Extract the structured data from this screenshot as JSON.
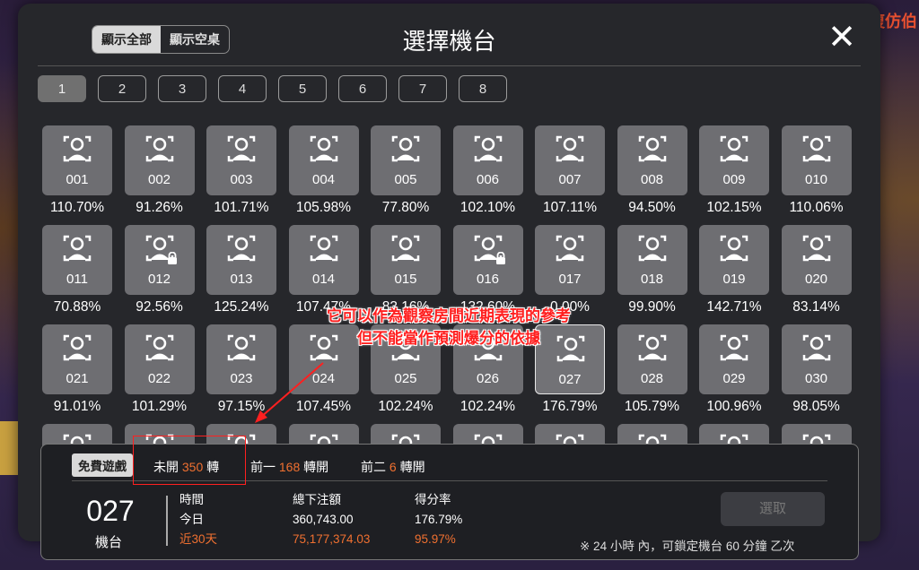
{
  "background": {
    "right_text": "復仿伯"
  },
  "modal": {
    "title": "選擇機台",
    "toggle": {
      "show_all": "顯示全部",
      "show_empty": "顯示空桌"
    },
    "pages": [
      "1",
      "2",
      "3",
      "4",
      "5",
      "6",
      "7",
      "8"
    ],
    "active_page": "1",
    "machines": [
      {
        "num": "001",
        "rate": "110.70%",
        "locked": false
      },
      {
        "num": "002",
        "rate": "91.26%",
        "locked": false
      },
      {
        "num": "003",
        "rate": "101.71%",
        "locked": false
      },
      {
        "num": "004",
        "rate": "105.98%",
        "locked": false
      },
      {
        "num": "005",
        "rate": "77.80%",
        "locked": false
      },
      {
        "num": "006",
        "rate": "102.10%",
        "locked": false
      },
      {
        "num": "007",
        "rate": "107.11%",
        "locked": false
      },
      {
        "num": "008",
        "rate": "94.50%",
        "locked": false
      },
      {
        "num": "009",
        "rate": "102.15%",
        "locked": false
      },
      {
        "num": "010",
        "rate": "110.06%",
        "locked": false
      },
      {
        "num": "011",
        "rate": "70.88%",
        "locked": false
      },
      {
        "num": "012",
        "rate": "92.56%",
        "locked": true
      },
      {
        "num": "013",
        "rate": "125.24%",
        "locked": false
      },
      {
        "num": "014",
        "rate": "107.47%",
        "locked": false
      },
      {
        "num": "015",
        "rate": "83.16%",
        "locked": false
      },
      {
        "num": "016",
        "rate": "132.60%",
        "locked": true
      },
      {
        "num": "017",
        "rate": "0.00%",
        "locked": false
      },
      {
        "num": "018",
        "rate": "99.90%",
        "locked": false
      },
      {
        "num": "019",
        "rate": "142.71%",
        "locked": false
      },
      {
        "num": "020",
        "rate": "83.14%",
        "locked": false
      },
      {
        "num": "021",
        "rate": "91.01%",
        "locked": false
      },
      {
        "num": "022",
        "rate": "101.29%",
        "locked": false
      },
      {
        "num": "023",
        "rate": "97.15%",
        "locked": false
      },
      {
        "num": "024",
        "rate": "107.45%",
        "locked": false
      },
      {
        "num": "025",
        "rate": "102.24%",
        "locked": false
      },
      {
        "num": "026",
        "rate": "102.24%",
        "locked": false
      },
      {
        "num": "027",
        "rate": "176.79%",
        "locked": false
      },
      {
        "num": "028",
        "rate": "105.79%",
        "locked": false
      },
      {
        "num": "029",
        "rate": "100.96%",
        "locked": false
      },
      {
        "num": "030",
        "rate": "98.05%",
        "locked": false
      }
    ],
    "selected_machine": "027"
  },
  "annotation": {
    "line1": "它可以作為觀察房間近期表現的參考",
    "line2": "但不能當作預測爆分的依據"
  },
  "panel": {
    "free_games_tag": "免費遊戲",
    "unopened_label": "未開",
    "unopened_value": "350",
    "unopened_unit": "轉",
    "prev1_label": "前一",
    "prev1_value": "168",
    "prev1_unit": "轉開",
    "prev2_label": "前二",
    "prev2_value": "6",
    "prev2_unit": "轉開",
    "machine_number": "027",
    "machine_label": "機台",
    "col_time_header": "時間",
    "col_time_today": "今日",
    "col_time_30d": "近30天",
    "col_bet_header": "總下注額",
    "col_bet_today": "360,743.00",
    "col_bet_30d": "75,177,374.03",
    "col_rate_header": "得分率",
    "col_rate_today": "176.79%",
    "col_rate_30d": "95.97%",
    "choose_button": "選取",
    "note": "※ 24 小時 內，可鎖定機台 60 分鐘 乙次"
  },
  "colors": {
    "accent_orange": "#f07030",
    "annotation_red": "#ff2020"
  }
}
